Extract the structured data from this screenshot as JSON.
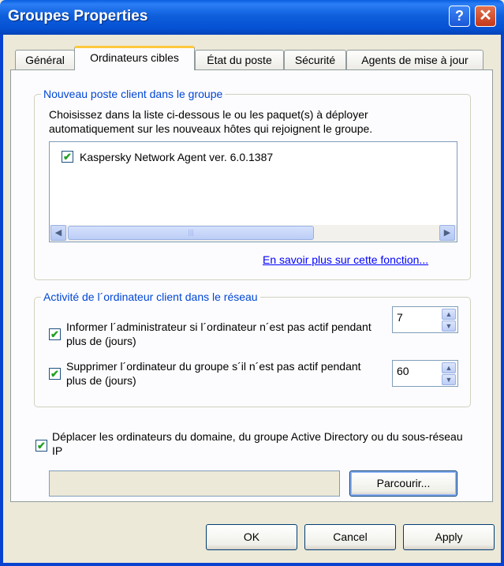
{
  "window": {
    "title": "Groupes Properties",
    "help_label": "?",
    "close_label": "✕"
  },
  "tabs": [
    {
      "label": "Général"
    },
    {
      "label": "Ordinateurs cibles"
    },
    {
      "label": "État du poste"
    },
    {
      "label": "Sécurité"
    },
    {
      "label": "Agents de mise à jour"
    }
  ],
  "new_client_group": {
    "legend": "Nouveau poste client dans le groupe",
    "description": "Choisissez dans la liste ci-dessous le ou les paquet(s) à déployer automatiquement sur les nouveaux hôtes qui rejoignent le groupe.",
    "packages": [
      {
        "label": "Kaspersky Network Agent ver. 6.0.1387",
        "checked": true
      }
    ],
    "more_info_link": "En savoir plus sur cette fonction..."
  },
  "activity_group": {
    "legend": "Activité de l´ordinateur client dans le réseau",
    "notify_label": "Informer l´administrateur si l´ordinateur n´est pas actif pendant plus de (jours)",
    "notify_checked": true,
    "notify_days": "7",
    "delete_label": "Supprimer l´ordinateur du groupe s´il n´est pas actif pendant plus de (jours)",
    "delete_checked": true,
    "delete_days": "60"
  },
  "move_computers": {
    "label": "Déplacer les ordinateurs du domaine, du groupe Active Directory ou du sous-réseau IP",
    "checked": true,
    "path_value": "",
    "browse_label": "Parcourir..."
  },
  "buttons": {
    "ok": "OK",
    "cancel": "Cancel",
    "apply": "Apply"
  },
  "icons": {
    "check": "✔",
    "scroll_left": "◀",
    "scroll_right": "▶",
    "spin_up": "▲",
    "spin_down": "▼",
    "thumb_grip": "|||"
  }
}
